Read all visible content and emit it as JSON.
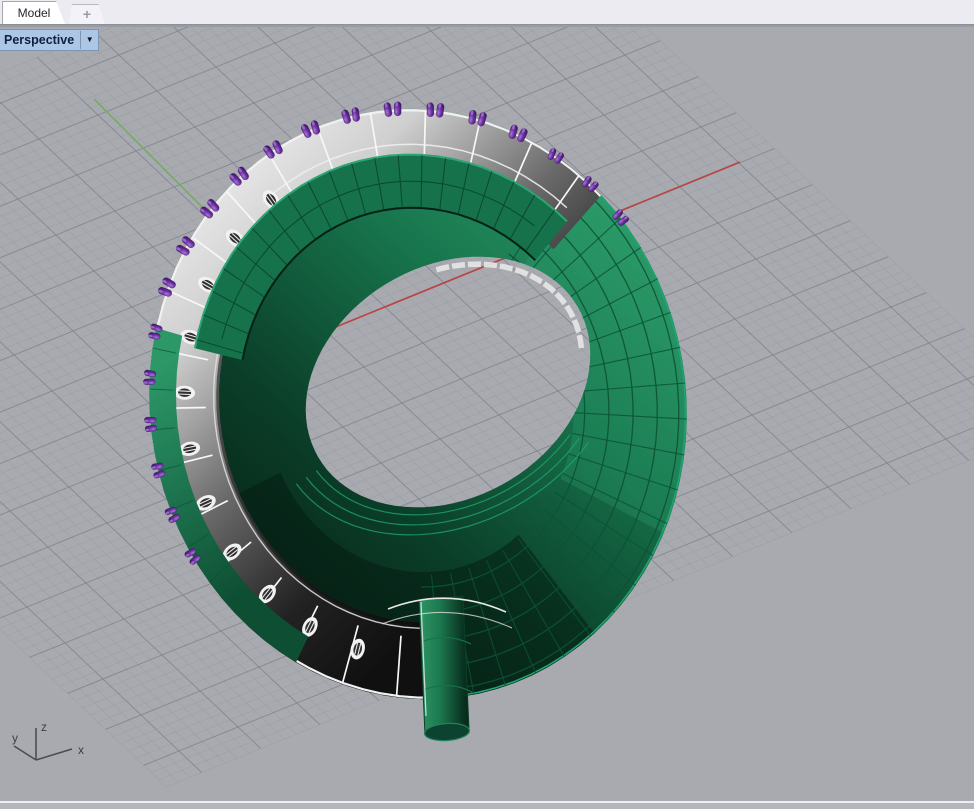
{
  "window": {
    "tabs": [
      {
        "label": "Model",
        "active": true
      },
      {
        "label": "+",
        "is_new_tab": true
      }
    ]
  },
  "viewport": {
    "label": "Perspective",
    "dropdown_glyph": "▼"
  },
  "axis_gizmo": {
    "x": "x",
    "y": "y",
    "z": "z"
  },
  "scene": {
    "colors": {
      "background": "#a8aab0",
      "grid_major": "#7d8089",
      "grid_minor": "#898c95",
      "axis_x_red": "#b94545",
      "axis_y_green": "#76aa6e",
      "ring_green": "#1d8a58",
      "ring_green_dark": "#07301f",
      "ring_green_bright": "#2fa474",
      "wire_green_dark": "#0c5236",
      "wire_green_bright": "#1fa371",
      "silver_light": "#f4f4f4",
      "silver_dark": "#161616",
      "wire_white": "#f7f7f7",
      "prong_purple": "#6b2fa0",
      "prong_purple_light": "#a877d4",
      "prong_purple_dark": "#3a1560",
      "gizmo_gray": "#4a4d52"
    }
  }
}
